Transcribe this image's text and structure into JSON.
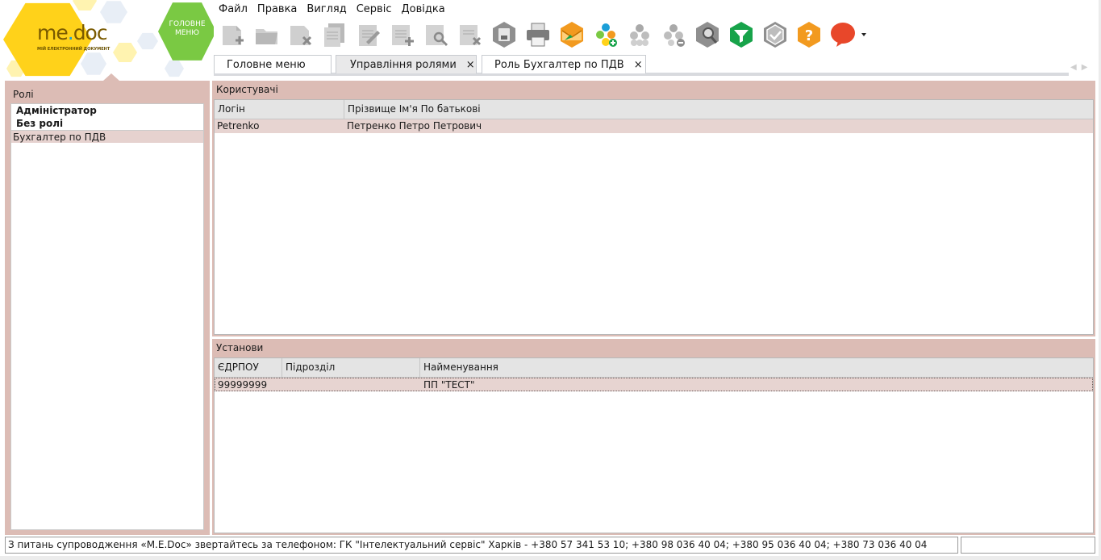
{
  "logo": {
    "brand_left": "me",
    "brand_dot": ".",
    "brand_right": "doc",
    "tagline": "МІЙ ЕЛЕКТРОННИЙ ДОКУМЕНТ"
  },
  "main_menu_button": {
    "line1": "ГОЛОВНЕ",
    "line2": "МЕНЮ"
  },
  "menubar": [
    "Файл",
    "Правка",
    "Вигляд",
    "Сервіс",
    "Довідка"
  ],
  "toolbar": [
    "new-document-icon",
    "open-document-icon",
    "delete-document-icon",
    "copy-document-icon",
    "edit-document-icon",
    "add-row-icon",
    "find-document-icon",
    "remove-row-icon",
    "save-icon",
    "print-icon",
    "send-envelope-icon",
    "add-group-icon",
    "group-icon",
    "remove-group-icon",
    "search-icon",
    "filter-icon",
    "verify-icon",
    "help-icon",
    "chat-bubble-icon",
    "dropdown-arrow-icon"
  ],
  "tabs": [
    {
      "label": "Головне меню",
      "closable": false
    },
    {
      "label": "Управління ролями",
      "closable": true,
      "active": true
    },
    {
      "label": "Роль Бухгалтер по ПДВ",
      "closable": true
    }
  ],
  "close_glyph": "×",
  "roles": {
    "header": "Ролі",
    "items": [
      "Адміністратор",
      "Без ролі",
      "Бухгалтер по ПДВ"
    ]
  },
  "users": {
    "title": "Користувачі",
    "columns": [
      "Логін",
      "Прізвище Ім'я По батькові"
    ],
    "rows": [
      [
        "Petrenko",
        "Петренко Петро Петрович"
      ]
    ]
  },
  "institutions": {
    "title": "Установи",
    "columns": [
      "ЄДРПОУ",
      "Підрозділ",
      "Найменування"
    ],
    "rows": [
      [
        "99999999",
        "",
        "ПП \"ТЕСТ\""
      ]
    ]
  },
  "status": {
    "message": "З питань супроводження «M.E.Doc» звертайтесь за телефоном: ГК \"Інтелектуальний сервіс\" Харків - +380 57 341 53 10; +380 98 036 40 04; +380 95 036 40 04; +380 73 036 40 04",
    "right": ""
  },
  "colors": {
    "panel": "#dcbcb5",
    "selection": "#e7d4d1",
    "logo_yellow": "#ffd21a",
    "menu_green": "#7ac943",
    "orange": "#f29a1f",
    "green_icon": "#17a34a",
    "red_bubble": "#e8472a"
  }
}
